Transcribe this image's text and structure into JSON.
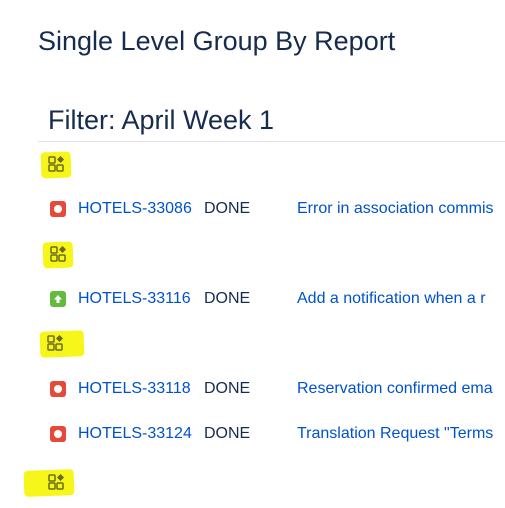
{
  "page": {
    "title": "Single Level Group By Report"
  },
  "filter": {
    "heading": "Filter: April Week 1"
  },
  "colors": {
    "highlight": "#f7f61a",
    "link": "#0052cc",
    "text": "#172b4d",
    "bug": "#e5493a",
    "improvement": "#63ba3c"
  },
  "groups": [
    {
      "icon": "group-by-icon",
      "issues": [
        {
          "type": "bug",
          "key": "HOTELS-33086",
          "status": "DONE",
          "summary": "Error in association commis"
        }
      ]
    },
    {
      "icon": "group-by-icon",
      "issues": [
        {
          "type": "improvement",
          "key": "HOTELS-33116",
          "status": "DONE",
          "summary": "Add a notification when a r"
        }
      ]
    },
    {
      "icon": "group-by-icon",
      "issues": [
        {
          "type": "bug",
          "key": "HOTELS-33118",
          "status": "DONE",
          "summary": "Reservation confirmed ema"
        },
        {
          "type": "bug",
          "key": "HOTELS-33124",
          "status": "DONE",
          "summary": "Translation Request \"Terms"
        }
      ]
    },
    {
      "icon": "group-by-icon",
      "issues": []
    }
  ]
}
